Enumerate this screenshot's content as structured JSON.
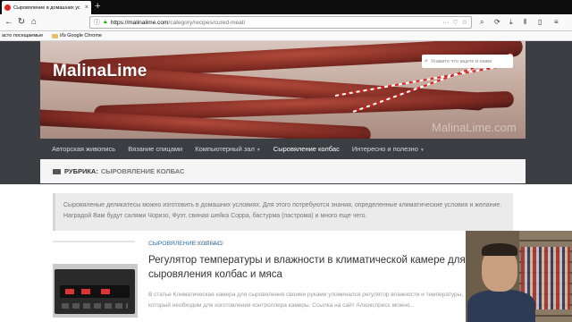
{
  "browser": {
    "tab_title": "Сыровяление в домашних ус",
    "tab_close": "×",
    "new_tab": "+",
    "url_host": "https://malinalime.com",
    "url_path": "/category/recipes/cured-meat/",
    "url_more": "···",
    "bookmarks": [
      "асто посещаемые",
      "Из Google Chrome"
    ]
  },
  "site": {
    "logo": "MalinaLime",
    "search_placeholder": "Укажите что ищете и нажм",
    "watermark": "MalinaLime.com",
    "menu": [
      {
        "label": "Авторская живопись",
        "has_caret": false
      },
      {
        "label": "Вязание спицами",
        "has_caret": false
      },
      {
        "label": "Компьютерный зал",
        "has_caret": true
      },
      {
        "label": "Сыровяление колбас",
        "has_caret": false,
        "active": true
      },
      {
        "label": "Интересно и полезно",
        "has_caret": true
      }
    ],
    "caret": "▼"
  },
  "rubric": {
    "label": "РУБРИКА:",
    "value": "СЫРОВЯЛЕНИЕ КОЛБАС"
  },
  "description": "Сыровяленые деликатесы можно изготовить в домашних условиях. Для этого потребуются знания, определенные климатические условия и желание. Наградой Вам будут салями Чоризо, Фуэт, свиная шейка Coppa, бастурма (пастрома) и много еще чего.",
  "post": {
    "category": "СЫРОВЯЛЕНИЕ КОЛБАС",
    "date": "21.03.2019",
    "title": "Регулятор температуры и влажности в климатической камере для сыровяления колбас и мяса",
    "excerpt": "В статье Климатическая камера для сыровяления своими руками упоминался регулятор влажности и температуры, который необходим для изготовления контроллера камеры. Ссылка на сайт Алиэкспресс можно..."
  }
}
